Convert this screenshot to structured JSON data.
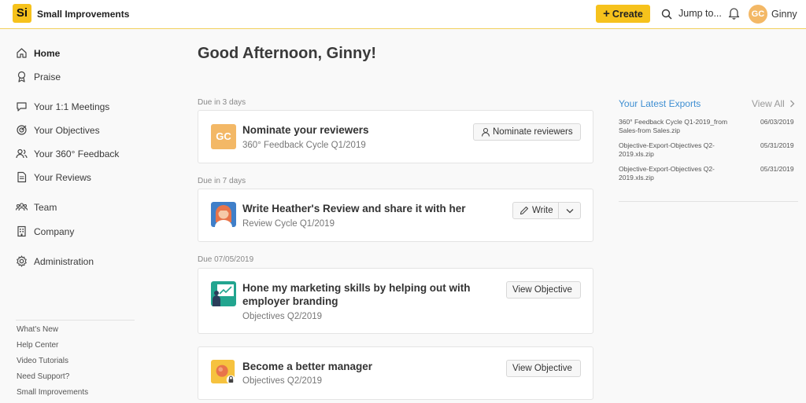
{
  "app": {
    "logo_text": "Si",
    "brand": "Small Improvements"
  },
  "topbar": {
    "create_label": "Create",
    "jump_label": "Jump to...",
    "avatar_initials": "GC",
    "user_name": "Ginny"
  },
  "sidebar": {
    "items": [
      {
        "label": "Home",
        "icon": "home-icon"
      },
      {
        "label": "Praise",
        "icon": "award-icon"
      },
      {
        "label": "Your 1:1 Meetings",
        "icon": "chat-icon"
      },
      {
        "label": "Your Objectives",
        "icon": "target-icon"
      },
      {
        "label": "Your 360° Feedback",
        "icon": "people-icon"
      },
      {
        "label": "Your Reviews",
        "icon": "document-icon"
      },
      {
        "label": "Team",
        "icon": "team-icon"
      },
      {
        "label": "Company",
        "icon": "building-icon"
      },
      {
        "label": "Administration",
        "icon": "gear-icon"
      }
    ],
    "footer": [
      "What's New",
      "Help Center",
      "Video Tutorials",
      "Need Support?",
      "Small Improvements"
    ]
  },
  "main": {
    "greeting": "Good Afternoon, Ginny!",
    "tasks": [
      {
        "due": "Due in 3 days",
        "title": "Nominate your reviewers",
        "subtitle": "360° Feedback Cycle Q1/2019",
        "avatar": "GC",
        "action": "Nominate reviewers"
      },
      {
        "due": "Due in 7 days",
        "title": "Write Heather's Review and share it with her",
        "subtitle": "Review Cycle Q1/2019",
        "action": "Write"
      },
      {
        "due": "Due 07/05/2019",
        "title_line1": "Hone my marketing skills by helping out with",
        "title_line2": "employer branding",
        "subtitle": "Objectives Q2/2019",
        "action": "View Objective"
      },
      {
        "title": "Become a better manager",
        "subtitle": "Objectives Q2/2019",
        "action": "View Objective"
      }
    ]
  },
  "exports": {
    "title": "Your Latest Exports",
    "view_all": "View All",
    "items": [
      {
        "name_line1": "360° Feedback Cycle Q1-2019_from",
        "name_line2": "Sales-from Sales.zip",
        "date": "06/03/2019"
      },
      {
        "name_line1": "Objective-Export-Objectives Q2-",
        "name_line2": "2019.xls.zip",
        "date": "05/31/2019"
      },
      {
        "name_line1": "Objective-Export-Objectives Q2-",
        "name_line2": "2019.xls.zip",
        "date": "05/31/2019"
      }
    ]
  },
  "colors": {
    "brand_yellow": "#f6c21c",
    "link_blue": "#3f8fd2",
    "avatar_orange": "#f3b866"
  }
}
